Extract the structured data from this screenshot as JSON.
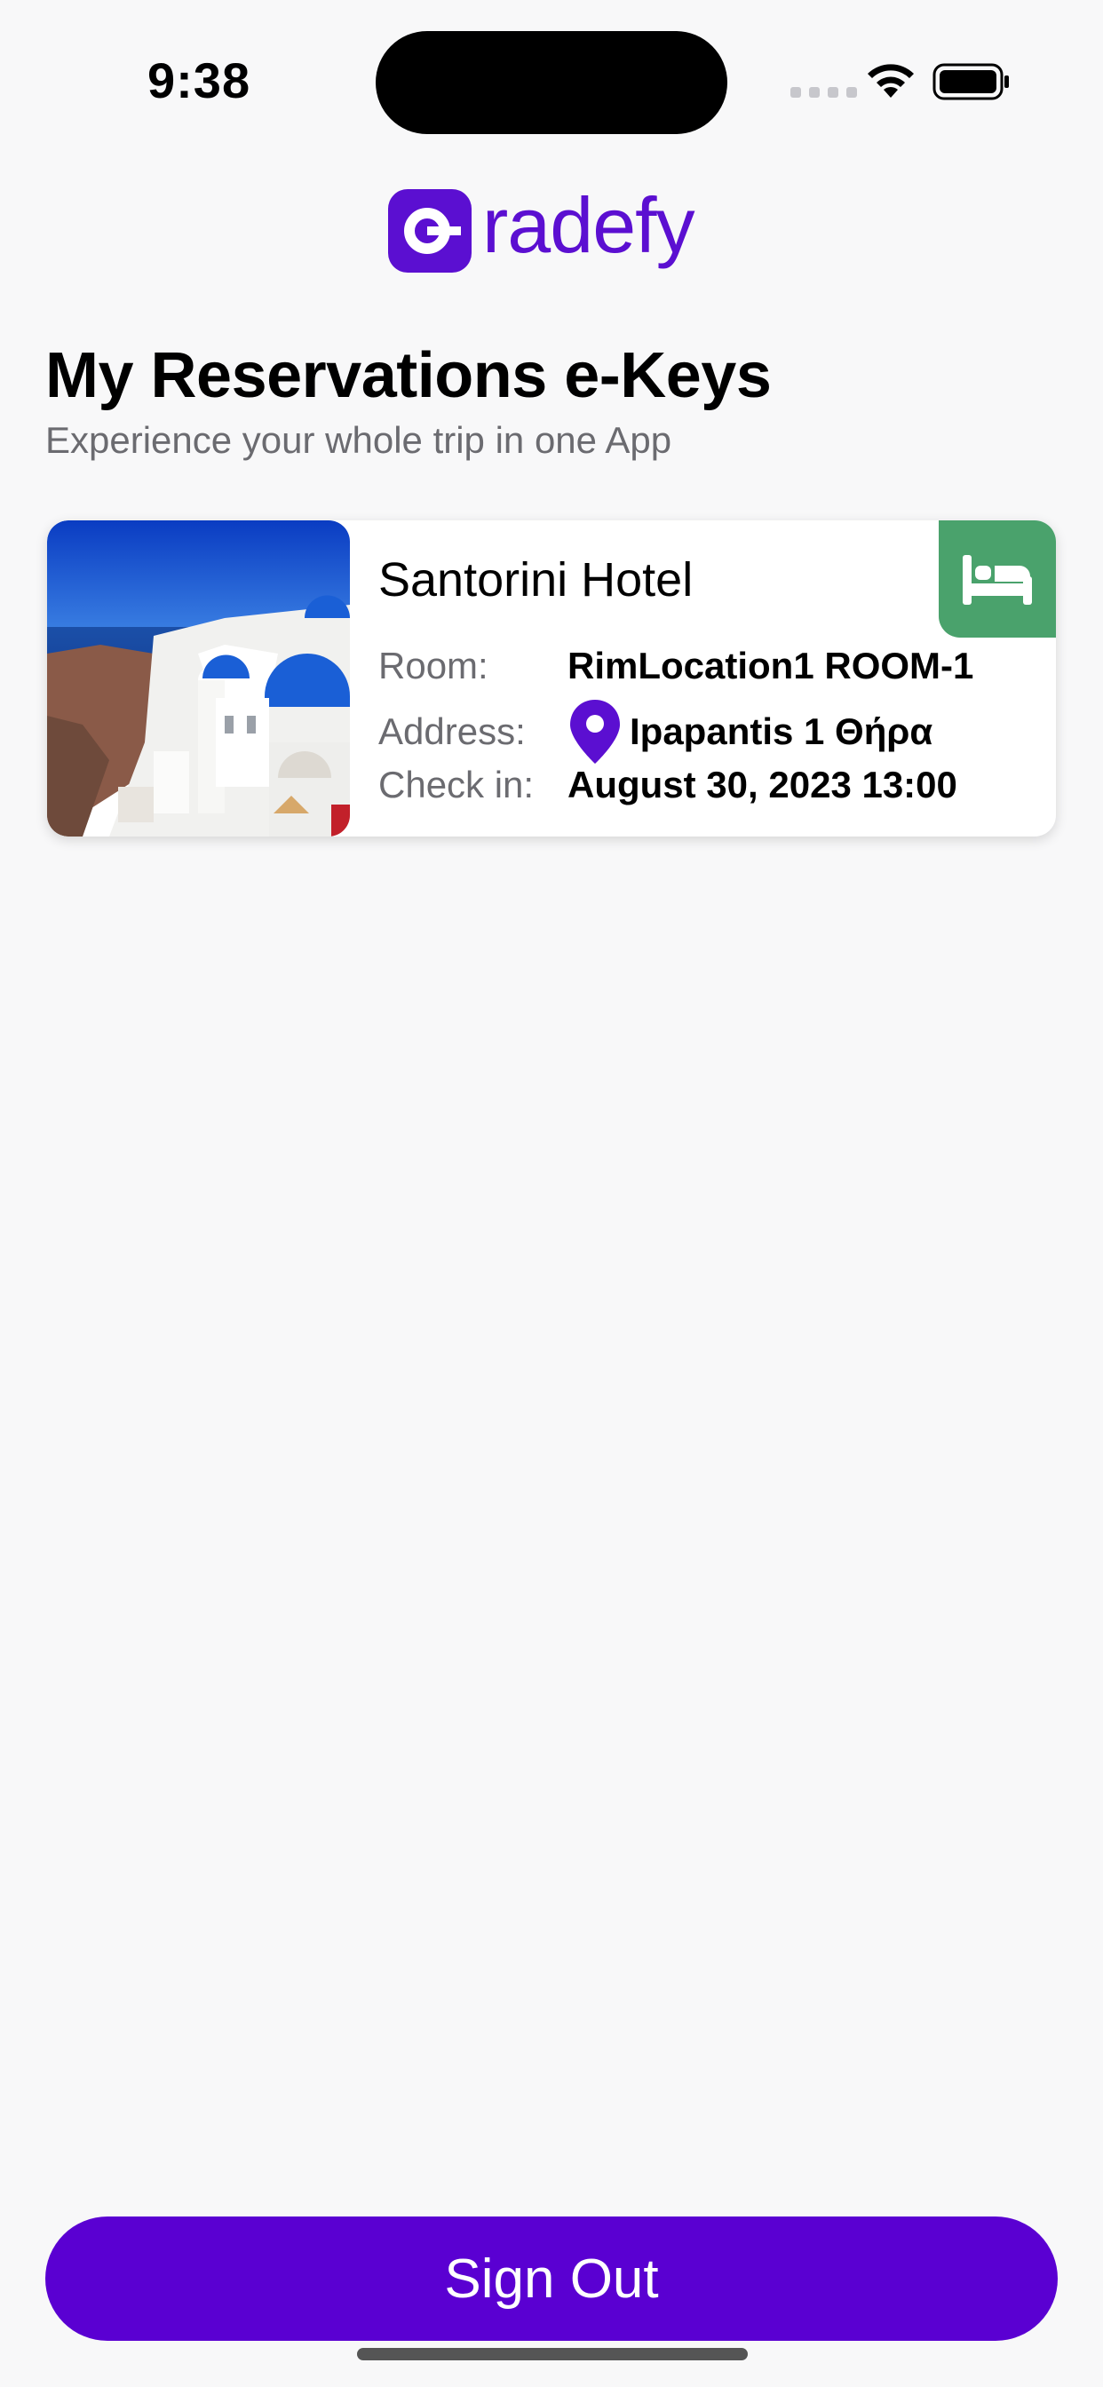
{
  "status_bar": {
    "time": "9:38"
  },
  "brand": {
    "name": "radefy",
    "color": "#5b0fd1"
  },
  "header": {
    "title": "My Reservations e-Keys",
    "subtitle": "Experience your whole trip in one App"
  },
  "reservations": [
    {
      "hotel": "Santorini Hotel",
      "room_label": "Room:",
      "room": "RimLocation1 ROOM-1",
      "address_label": "Address:",
      "address": "Ipapantis 1 Θήρα",
      "checkin_label": "Check in:",
      "checkin": "August 30, 2023 13:00",
      "badge_icon": "bed-icon",
      "badge_color": "#4aa26c"
    }
  ],
  "footer": {
    "signout_label": "Sign Out",
    "signout_color": "#5a00d2"
  }
}
